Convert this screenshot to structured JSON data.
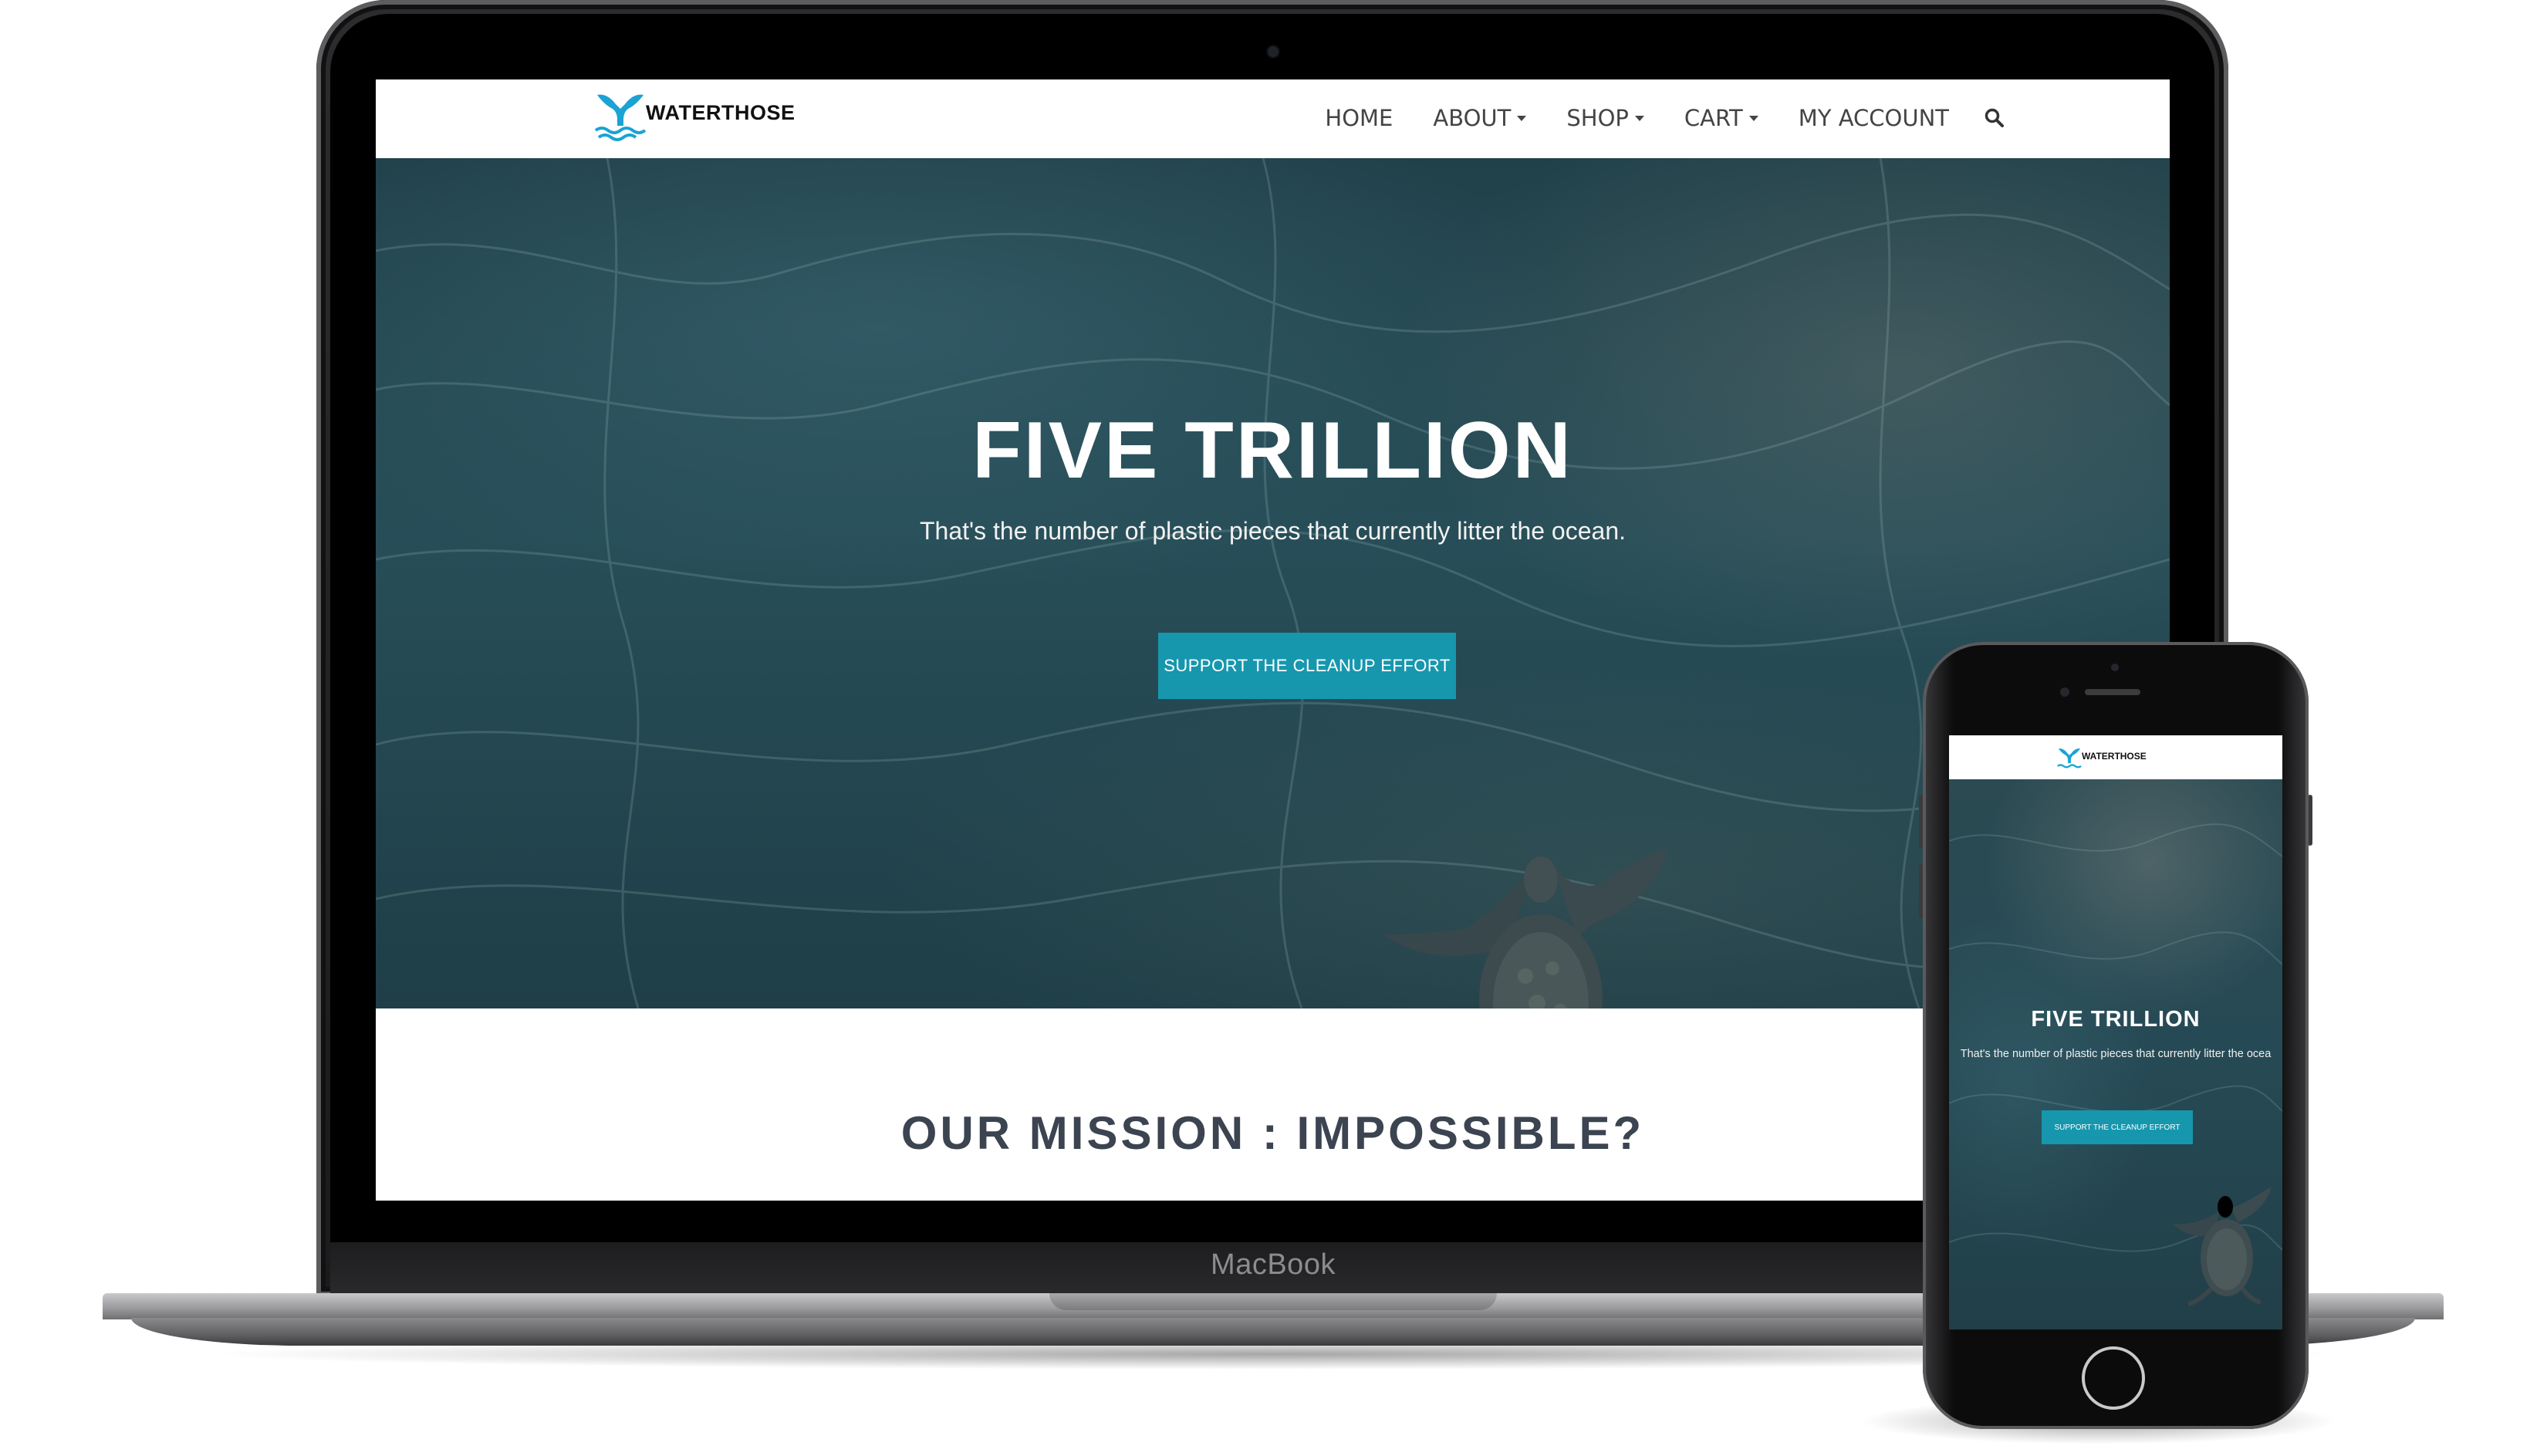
{
  "devices": {
    "laptop_brand": "MacBook"
  },
  "site": {
    "brand": "WATERTHOSE",
    "nav": [
      {
        "label": "HOME",
        "has_dropdown": false
      },
      {
        "label": "ABOUT",
        "has_dropdown": true
      },
      {
        "label": "SHOP",
        "has_dropdown": true
      },
      {
        "label": "CART",
        "has_dropdown": true
      },
      {
        "label": "MY ACCOUNT",
        "has_dropdown": false
      }
    ],
    "search_icon": "search-icon",
    "hero": {
      "title": "FIVE TRILLION",
      "subtitle": "That's the number of plastic pieces that currently litter the ocean.",
      "button": "SUPPORT THE CLEANUP EFFORT"
    },
    "mission_title": "OUR MISSION : IMPOSSIBLE?"
  },
  "mobile": {
    "brand": "WATERTHOSE",
    "hero": {
      "title": "FIVE TRILLION",
      "subtitle": "That's the number of plastic pieces that currently litter the ocea",
      "button": "SUPPORT THE CLEANUP EFFORT"
    }
  },
  "colors": {
    "accent": "#1697ae",
    "logo_blue": "#1aa3d4",
    "hero_dark": "#21414a"
  }
}
